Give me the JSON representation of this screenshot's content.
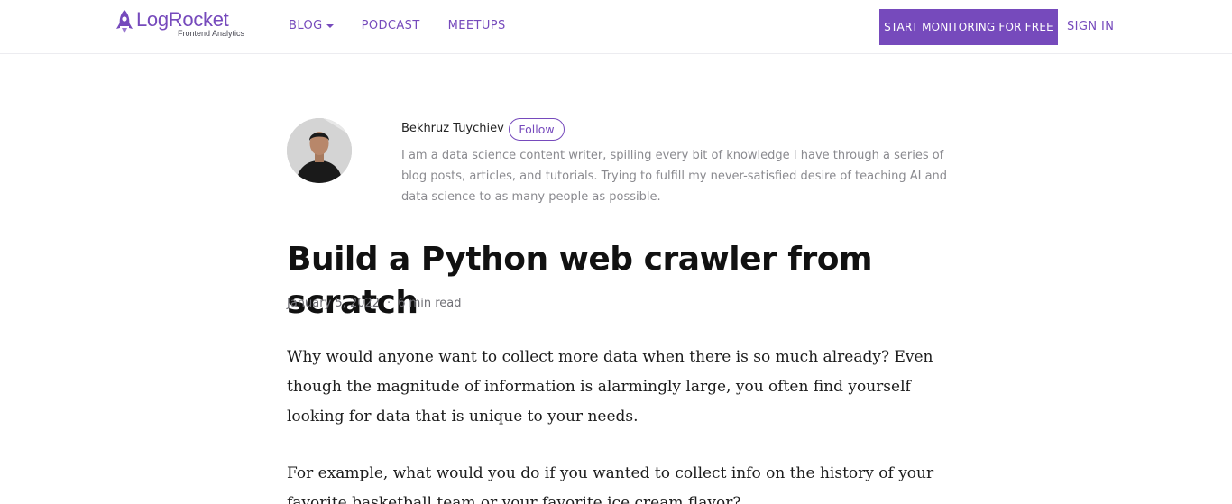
{
  "header": {
    "logo": {
      "wordmark": "LogRocket",
      "tagline": "Frontend Analytics"
    },
    "nav": [
      {
        "label": "BLOG",
        "has_dropdown": true
      },
      {
        "label": "PODCAST",
        "has_dropdown": false
      },
      {
        "label": "MEETUPS",
        "has_dropdown": false
      }
    ],
    "cta_label": "START MONITORING FOR FREE",
    "signin_label": "SIGN IN"
  },
  "author": {
    "name": "Bekhruz Tuychiev",
    "follow_label": "Follow",
    "bio": "I am a data science content writer, spilling every bit of knowledge I have through a series of blog posts, articles, and tutorials. Trying to fulfill my never-satisfied desire of teaching AI and data science to as many people as possible."
  },
  "article": {
    "title": "Build a Python web crawler from scratch",
    "date": "January 5, 2022",
    "separator": "·",
    "read_time": "6 min read",
    "paragraphs": [
      "Why would anyone want to collect more data when there is so much already? Even though the magnitude of information is alarmingly large, you often find yourself looking for data that is unique to your needs.",
      "For example, what would you do if you wanted to collect info on the history of your favorite basketball team or your favorite ice cream flavor?"
    ]
  },
  "colors": {
    "brand": "#764abc",
    "text": "#1b1b1b",
    "muted": "#8a8a8f",
    "divider": "#ececf0"
  },
  "icons": {
    "logo": "rocket-logo-icon",
    "dropdown": "caret-down-icon",
    "avatar": "author-avatar"
  }
}
